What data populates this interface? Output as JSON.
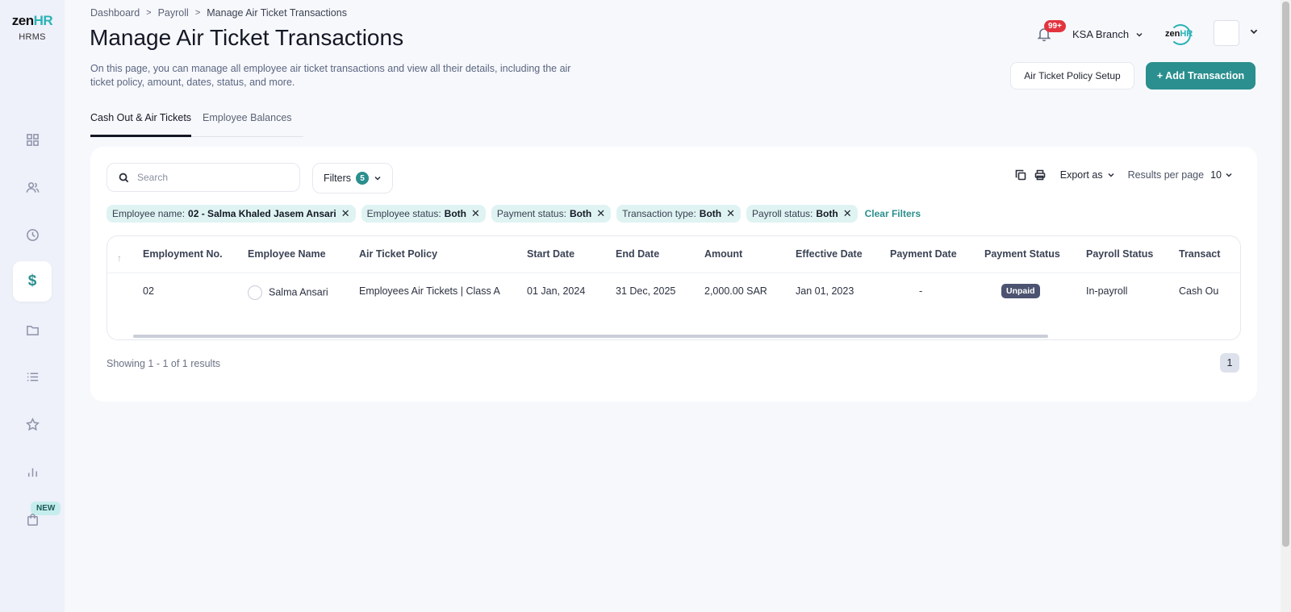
{
  "brand": {
    "logo_zen": "zen",
    "logo_hr": "HR",
    "subtitle": "HRMS",
    "new_badge": "NEW"
  },
  "breadcrumb": [
    "Dashboard",
    "Payroll",
    "Manage Air Ticket Transactions"
  ],
  "page": {
    "title": "Manage Air Ticket Transactions",
    "description": "On this page, you can manage all employee air ticket transactions and view all their details, including the air ticket policy, amount, dates, status, and more."
  },
  "header": {
    "notification_count": "99+",
    "branch": "KSA Branch",
    "mini_logo_zen": "zen",
    "mini_logo_hr": "HR"
  },
  "actions": {
    "policy_setup": "Air Ticket Policy Setup",
    "add_transaction": "+ Add Transaction"
  },
  "tabs": [
    {
      "label": "Cash Out & Air Tickets",
      "active": true
    },
    {
      "label": "Employee Balances",
      "active": false
    }
  ],
  "toolbar": {
    "search_placeholder": "Search",
    "filters_label": "Filters",
    "filters_count": "5",
    "export_label": "Export as",
    "rpp_label": "Results per page",
    "rpp_value": "10"
  },
  "chips": [
    {
      "key": "Employee name:",
      "value": "02 - Salma Khaled Jasem Ansari"
    },
    {
      "key": "Employee status:",
      "value": "Both"
    },
    {
      "key": "Payment status:",
      "value": "Both"
    },
    {
      "key": "Transaction type:",
      "value": "Both"
    },
    {
      "key": "Payroll status:",
      "value": "Both"
    }
  ],
  "clear_filters": "Clear Filters",
  "table": {
    "columns": [
      "Employment No.",
      "Employee Name",
      "Air Ticket Policy",
      "Start Date",
      "End Date",
      "Amount",
      "Effective Date",
      "Payment Date",
      "Payment Status",
      "Payroll Status",
      "Transact"
    ],
    "rows": [
      {
        "employment_no": "02",
        "employee_name": "Salma Ansari",
        "policy": "Employees Air Tickets | Class A",
        "start_date": "01 Jan, 2024",
        "end_date": "31 Dec, 2025",
        "amount": "2,000.00 SAR",
        "effective_date": "Jan 01, 2023",
        "payment_date": "-",
        "payment_status": "Unpaid",
        "payroll_status": "In-payroll",
        "transaction_type": "Cash Ou"
      }
    ]
  },
  "footer": {
    "showing": "Showing 1 - 1 of 1 results",
    "page": "1"
  },
  "colors": {
    "accent": "#2a8f8e",
    "sidebar_bg": "#eef0fa",
    "badge_red": "#e2343f",
    "chip_bg": "#dff3f2"
  },
  "icons": [
    "dashboard-icon",
    "people-icon",
    "clock-icon",
    "dollar-icon",
    "folder-icon",
    "list-icon",
    "star-icon",
    "bar-chart-icon",
    "bag-icon",
    "bell-icon",
    "search-icon",
    "copy-icon",
    "print-icon",
    "chevron-down-icon",
    "close-icon"
  ]
}
